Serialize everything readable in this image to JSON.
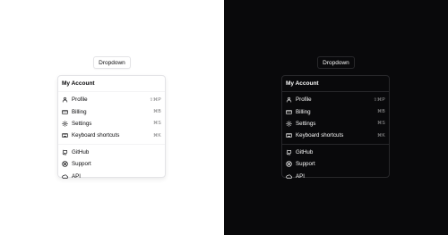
{
  "trigger": {
    "label": "Dropdown"
  },
  "menu": {
    "label": "My Account",
    "group1": [
      {
        "label": "Profile",
        "shortcut": "⇧⌘P",
        "icon": "user-icon"
      },
      {
        "label": "Billing",
        "shortcut": "⌘B",
        "icon": "credit-card-icon"
      },
      {
        "label": "Settings",
        "shortcut": "⌘S",
        "icon": "gear-icon"
      },
      {
        "label": "Keyboard shortcuts",
        "shortcut": "⌘K",
        "icon": "keyboard-icon"
      }
    ],
    "group2": [
      {
        "label": "GitHub",
        "icon": "github-icon"
      },
      {
        "label": "Support",
        "icon": "life-buoy-icon"
      },
      {
        "label": "API",
        "icon": "cloud-icon"
      }
    ]
  },
  "themes": {
    "light": {
      "background": "#ffffff",
      "text": "#09090b",
      "border": "#e4e4e7"
    },
    "dark": {
      "background": "#09090b",
      "text": "#fafafa",
      "border": "#27272a"
    }
  }
}
